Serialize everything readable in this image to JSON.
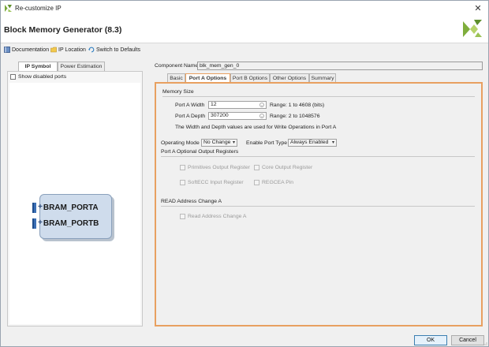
{
  "window": {
    "title": "Re-customize IP",
    "close_glyph": "✕"
  },
  "header": {
    "title": "Block Memory Generator (8.3)"
  },
  "toolbar": {
    "documentation": "Documentation",
    "ip_location": "IP Location",
    "switch_defaults": "Switch to Defaults"
  },
  "left": {
    "tabs": [
      "IP Symbol",
      "Power Estimation"
    ],
    "show_disabled_ports": "Show disabled ports",
    "ports": [
      "BRAM_PORTA",
      "BRAM_PORTB"
    ],
    "port_plus": "+"
  },
  "component": {
    "label": "Component Name",
    "value": "blk_mem_gen_0"
  },
  "tabs": [
    "Basic",
    "Port A Options",
    "Port B Options",
    "Other Options",
    "Summary"
  ],
  "memory_size": {
    "title": "Memory Size",
    "width_label": "Port A Width",
    "width_value": "12",
    "width_range": "Range: 1 to 4608 (bits)",
    "depth_label": "Port A Depth",
    "depth_value": "307200",
    "depth_range": "Range: 2 to 1048576",
    "note": "The Width and Depth values are used for Write Operations in Port A"
  },
  "operating": {
    "mode_label": "Operating Mode",
    "mode_value": "No Change",
    "enable_label": "Enable Port Type",
    "enable_value": "Always Enabled"
  },
  "optional_regs": {
    "title": "Port A Optional Output Registers",
    "primitives": "Primitives Output Register",
    "core": "Core Output Register",
    "softecc": "SoftECC Input Register",
    "regcea": "REGCEA Pin"
  },
  "read_addr": {
    "title": "READ Address Change A",
    "option": "Read Address Change A"
  },
  "footer": {
    "ok": "OK",
    "cancel": "Cancel"
  },
  "colors": {
    "accent_border": "#e8a060",
    "port_blue": "#3b6fb5",
    "block_fill": "#cfdcec"
  }
}
